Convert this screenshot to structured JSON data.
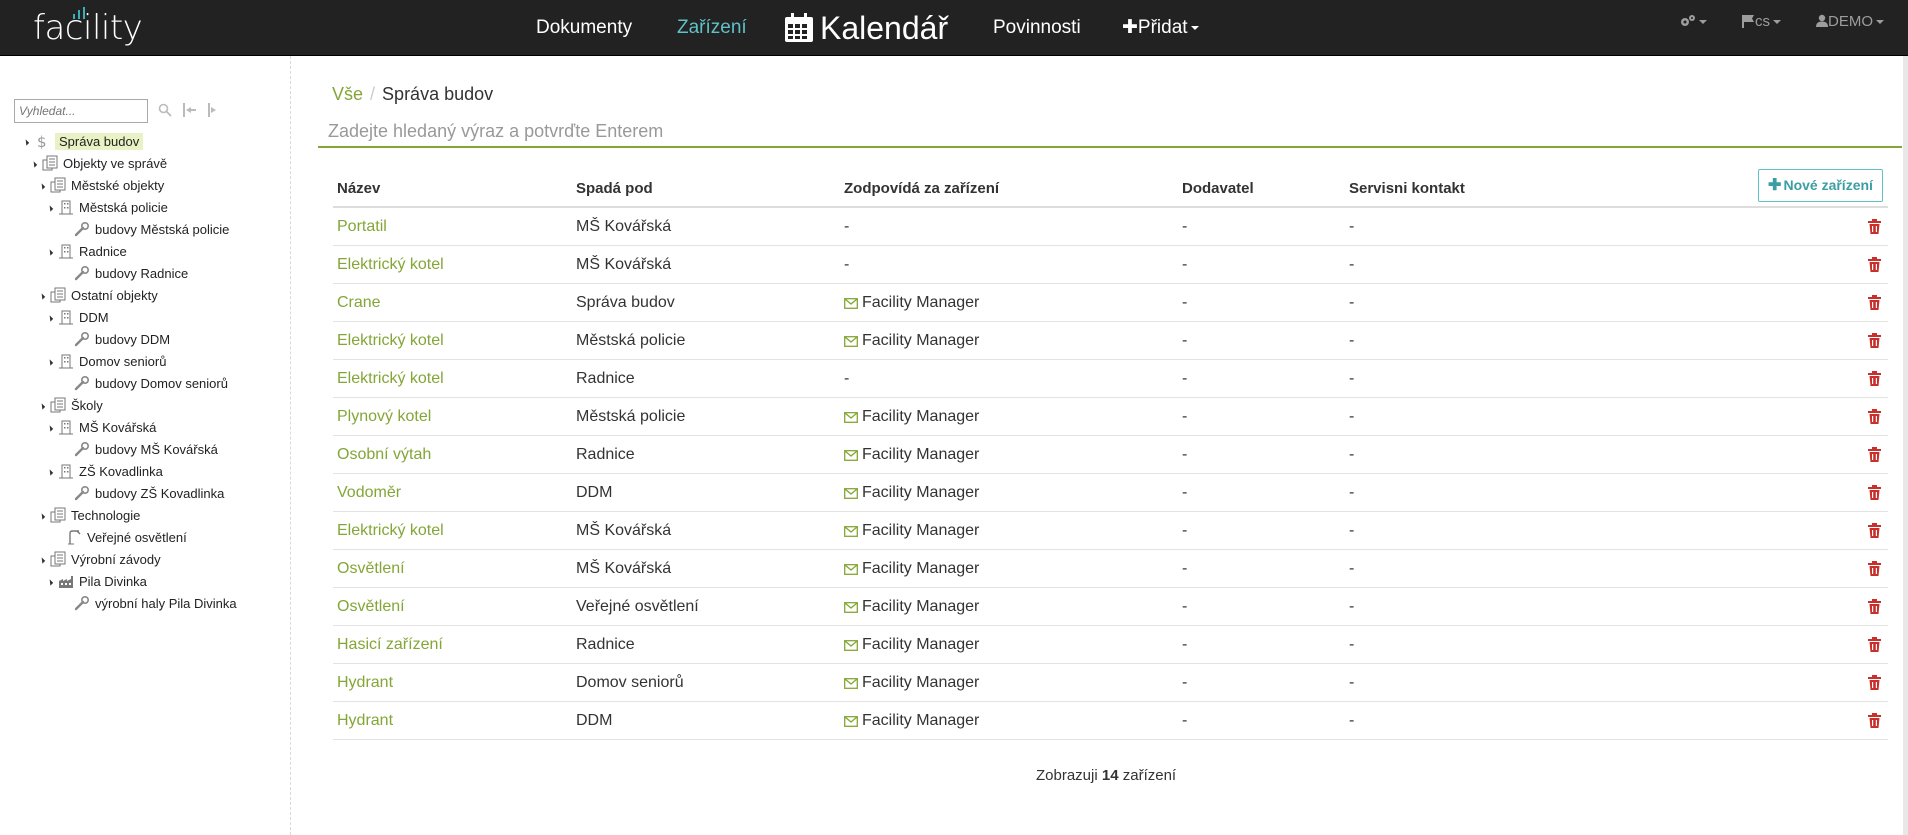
{
  "brand": {
    "logo_text": "facility"
  },
  "nav": {
    "items": [
      {
        "label": "Dokumenty",
        "active": false
      },
      {
        "label": "Zařízení",
        "active": true
      },
      {
        "label": "Kalendář",
        "active": false
      },
      {
        "label": "Povinnosti",
        "active": false
      },
      {
        "label": "Přidat",
        "active": false
      }
    ],
    "right": {
      "settings_icon": "gears-icon",
      "language": "cs",
      "user": "DEMO"
    }
  },
  "colors": {
    "accent_green": "#84a637",
    "accent_teal": "#5fc2c7",
    "danger_red": "#c9302c",
    "navbar_bg": "#222222"
  },
  "sidebar": {
    "search_placeholder": "Vyhledat...",
    "tree": [
      {
        "label": "Správa budov",
        "icon": "dollar-icon",
        "selected": true
      },
      {
        "label": "Objekty ve správě",
        "icon": "buildings-icon"
      },
      {
        "label": "Městské objekty",
        "icon": "buildings-icon"
      },
      {
        "label": "Městská policie",
        "icon": "building-icon"
      },
      {
        "label": "budovy Městská policie",
        "icon": "wrench-icon"
      },
      {
        "label": "Radnice",
        "icon": "building-icon"
      },
      {
        "label": "budovy Radnice",
        "icon": "wrench-icon"
      },
      {
        "label": "Ostatní objekty",
        "icon": "buildings-icon"
      },
      {
        "label": "DDM",
        "icon": "building-icon"
      },
      {
        "label": "budovy DDM",
        "icon": "wrench-icon"
      },
      {
        "label": "Domov seniorů",
        "icon": "building-icon"
      },
      {
        "label": "budovy Domov seniorů",
        "icon": "wrench-icon"
      },
      {
        "label": "Školy",
        "icon": "buildings-icon"
      },
      {
        "label": "MŠ Kovářská",
        "icon": "building-icon"
      },
      {
        "label": "budovy MŠ Kovářská",
        "icon": "wrench-icon"
      },
      {
        "label": "ZŠ Kovadlinka",
        "icon": "building-icon"
      },
      {
        "label": "budovy ZŠ Kovadlinka",
        "icon": "wrench-icon"
      },
      {
        "label": "Technologie",
        "icon": "buildings-icon"
      },
      {
        "label": "Veřejné osvětlení",
        "icon": "streetlight-icon"
      },
      {
        "label": "Výrobní závody",
        "icon": "buildings-icon"
      },
      {
        "label": "Pila Divinka",
        "icon": "factory-icon"
      },
      {
        "label": "výrobní haly Pila Divinka",
        "icon": "wrench-icon"
      }
    ]
  },
  "main": {
    "breadcrumb": {
      "root": "Vše",
      "current": "Správa budov"
    },
    "search_placeholder": "Zadejte hledaný výraz a potvrďte Enterem",
    "new_button_label": "Nové zařízení",
    "columns": [
      "Název",
      "Spadá pod",
      "Zodpovídá za zařízení",
      "Dodavatel",
      "Servisni kontakt"
    ],
    "rows": [
      {
        "name": "Portatil",
        "parent": "MŠ Kovářská",
        "responsible": "-",
        "has_mail": false,
        "supplier": "-",
        "contact": "-"
      },
      {
        "name": "Elektrický kotel",
        "parent": "MŠ Kovářská",
        "responsible": "-",
        "has_mail": false,
        "supplier": "-",
        "contact": "-"
      },
      {
        "name": "Crane",
        "parent": "Správa budov",
        "responsible": "Facility Manager",
        "has_mail": true,
        "supplier": "-",
        "contact": "-"
      },
      {
        "name": "Elektrický kotel",
        "parent": "Městská policie",
        "responsible": "Facility Manager",
        "has_mail": true,
        "supplier": "-",
        "contact": "-"
      },
      {
        "name": "Elektrický kotel",
        "parent": "Radnice",
        "responsible": "-",
        "has_mail": false,
        "supplier": "-",
        "contact": "-"
      },
      {
        "name": "Plynový kotel",
        "parent": "Městská policie",
        "responsible": "Facility Manager",
        "has_mail": true,
        "supplier": "-",
        "contact": "-"
      },
      {
        "name": "Osobní výtah",
        "parent": "Radnice",
        "responsible": "Facility Manager",
        "has_mail": true,
        "supplier": "-",
        "contact": "-"
      },
      {
        "name": "Vodoměr",
        "parent": "DDM",
        "responsible": "Facility Manager",
        "has_mail": true,
        "supplier": "-",
        "contact": "-"
      },
      {
        "name": "Elektrický kotel",
        "parent": "MŠ Kovářská",
        "responsible": "Facility Manager",
        "has_mail": true,
        "supplier": "-",
        "contact": "-"
      },
      {
        "name": "Osvětlení",
        "parent": "MŠ Kovářská",
        "responsible": "Facility Manager",
        "has_mail": true,
        "supplier": "-",
        "contact": "-"
      },
      {
        "name": "Osvětlení",
        "parent": "Veřejné osvětlení",
        "responsible": "Facility Manager",
        "has_mail": true,
        "supplier": "-",
        "contact": "-"
      },
      {
        "name": "Hasicí zařízení",
        "parent": "Radnice",
        "responsible": "Facility Manager",
        "has_mail": true,
        "supplier": "-",
        "contact": "-"
      },
      {
        "name": "Hydrant",
        "parent": "Domov seniorů",
        "responsible": "Facility Manager",
        "has_mail": true,
        "supplier": "-",
        "contact": "-"
      },
      {
        "name": "Hydrant",
        "parent": "DDM",
        "responsible": "Facility Manager",
        "has_mail": true,
        "supplier": "-",
        "contact": "-"
      }
    ],
    "summary": {
      "prefix": "Zobrazuji",
      "count": "14",
      "suffix": "zařízení"
    }
  }
}
